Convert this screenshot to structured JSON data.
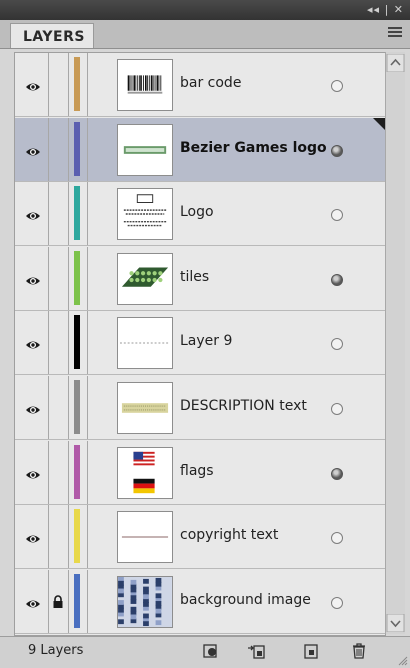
{
  "panel": {
    "tab_label": "LAYERS",
    "top_controls": "◂◂ | ✕",
    "menu_icon": "panel-menu-icon"
  },
  "layers": [
    {
      "name": "bar code",
      "color": "#c89a55",
      "visible": true,
      "locked": false,
      "selected": false,
      "target": "off",
      "thumb": "barcode"
    },
    {
      "name": "Bezier Games logo",
      "color": "#5b5fb0",
      "visible": true,
      "locked": false,
      "selected": true,
      "target": "on",
      "thumb": "bezier"
    },
    {
      "name": "Logo",
      "color": "#2ea89e",
      "visible": true,
      "locked": false,
      "selected": false,
      "target": "off",
      "thumb": "logo"
    },
    {
      "name": "tiles",
      "color": "#7cc24a",
      "visible": true,
      "locked": false,
      "selected": false,
      "target": "on",
      "thumb": "tiles"
    },
    {
      "name": "Layer 9",
      "color": "#000000",
      "visible": true,
      "locked": false,
      "selected": false,
      "target": "off",
      "thumb": "layer9"
    },
    {
      "name": "DESCRIPTION text",
      "color": "#8c8c8c",
      "visible": true,
      "locked": false,
      "selected": false,
      "target": "off",
      "thumb": "desc"
    },
    {
      "name": "flags",
      "color": "#b05aa8",
      "visible": true,
      "locked": false,
      "selected": false,
      "target": "on",
      "thumb": "flags"
    },
    {
      "name": "copyright text",
      "color": "#e8d84a",
      "visible": true,
      "locked": false,
      "selected": false,
      "target": "off",
      "thumb": "copyright"
    },
    {
      "name": "background image",
      "color": "#4a6fc0",
      "visible": true,
      "locked": true,
      "selected": false,
      "target": "off",
      "thumb": "bgimage"
    }
  ],
  "footer": {
    "count_label": "9 Layers",
    "buttons": [
      "make-clipping-mask-icon",
      "new-sublayer-icon",
      "new-layer-icon",
      "delete-layer-icon"
    ]
  }
}
